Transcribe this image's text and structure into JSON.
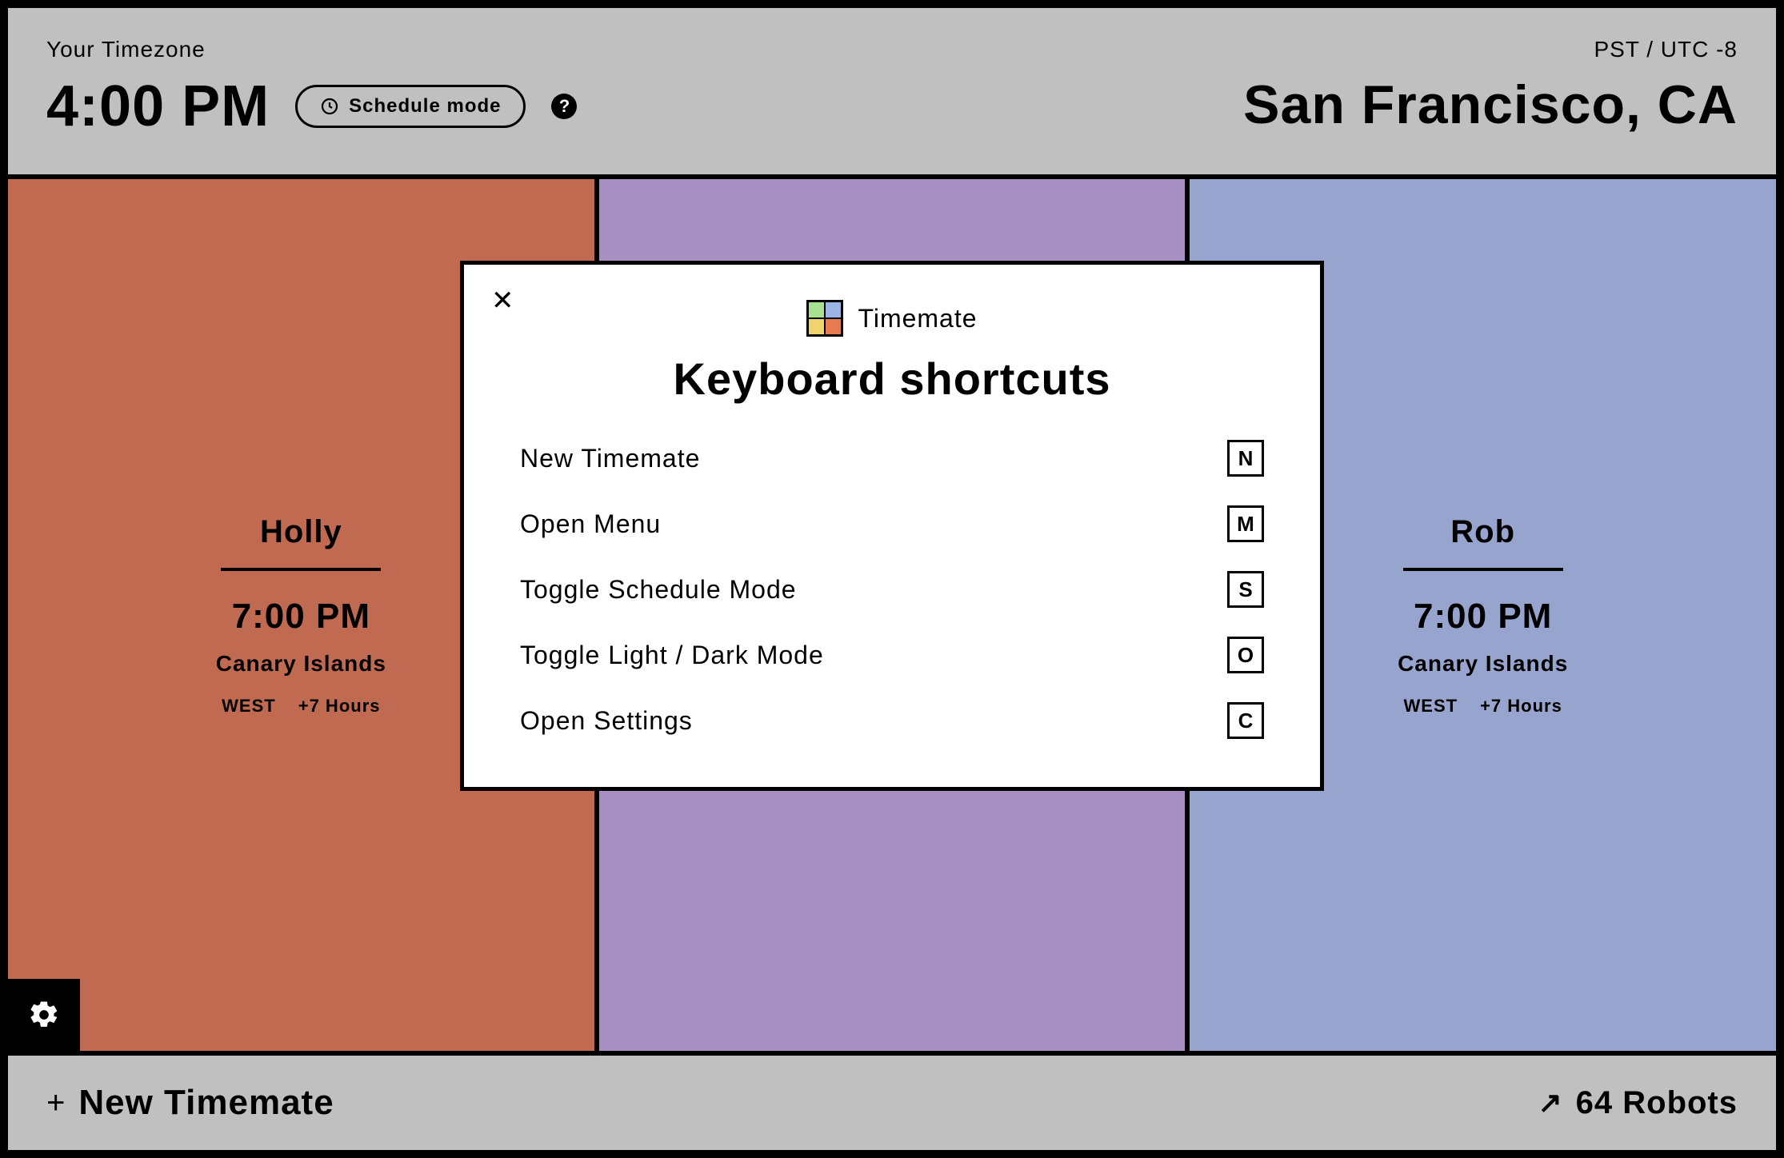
{
  "header": {
    "tz_label": "Your Timezone",
    "time": "4:00 PM",
    "schedule_button": "Schedule mode",
    "help": "?",
    "tz_code": "PST / UTC -8",
    "city": "San Francisco, CA"
  },
  "cards": [
    {
      "name": "Holly",
      "time": "7:00 PM",
      "location": "Canary Islands",
      "tz": "WEST",
      "offset": "+7 Hours"
    },
    {
      "name": "",
      "time": "",
      "location": "",
      "tz": "",
      "offset": ""
    },
    {
      "name": "Rob",
      "time": "7:00 PM",
      "location": "Canary Islands",
      "tz": "WEST",
      "offset": "+7 Hours"
    }
  ],
  "footer": {
    "new_label": "New Timemate",
    "robots": "64 Robots"
  },
  "modal": {
    "brand": "Timemate",
    "title": "Keyboard shortcuts",
    "shortcuts": [
      {
        "label": "New Timemate",
        "key": "N"
      },
      {
        "label": "Open Menu",
        "key": "M"
      },
      {
        "label": "Toggle Schedule Mode",
        "key": "S"
      },
      {
        "label": "Toggle Light / Dark Mode",
        "key": "O"
      },
      {
        "label": "Open Settings",
        "key": "C"
      }
    ]
  }
}
